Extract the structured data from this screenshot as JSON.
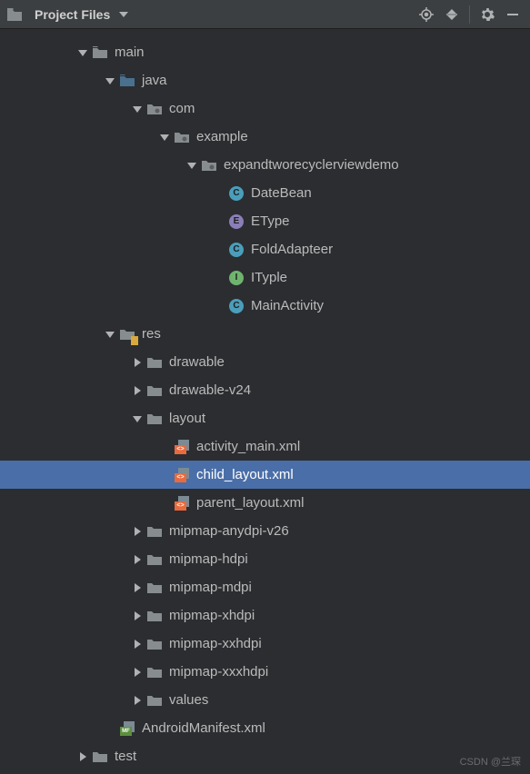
{
  "header": {
    "title": "Project Files"
  },
  "tree": {
    "main": "main",
    "java": "java",
    "com": "com",
    "example": "example",
    "package": "expandtworecyclerviewdemo",
    "classes": {
      "dateBean": "DateBean",
      "eType": "EType",
      "foldAdapter": "FoldAdapteer",
      "iTyple": "ITyple",
      "mainActivity": "MainActivity"
    },
    "res": "res",
    "resDirs": {
      "drawable": "drawable",
      "drawableV24": "drawable-v24",
      "layout": "layout",
      "layouts": {
        "activityMain": "activity_main.xml",
        "childLayout": "child_layout.xml",
        "parentLayout": "parent_layout.xml"
      },
      "mipmapAnydpiV26": "mipmap-anydpi-v26",
      "mipmapHdpi": "mipmap-hdpi",
      "mipmapMdpi": "mipmap-mdpi",
      "mipmapXhdpi": "mipmap-xhdpi",
      "mipmapXxhdpi": "mipmap-xxhdpi",
      "mipmapXxxhdpi": "mipmap-xxxhdpi",
      "values": "values"
    },
    "manifest": "AndroidManifest.xml",
    "test": "test"
  },
  "watermark": "CSDN @兰琛"
}
